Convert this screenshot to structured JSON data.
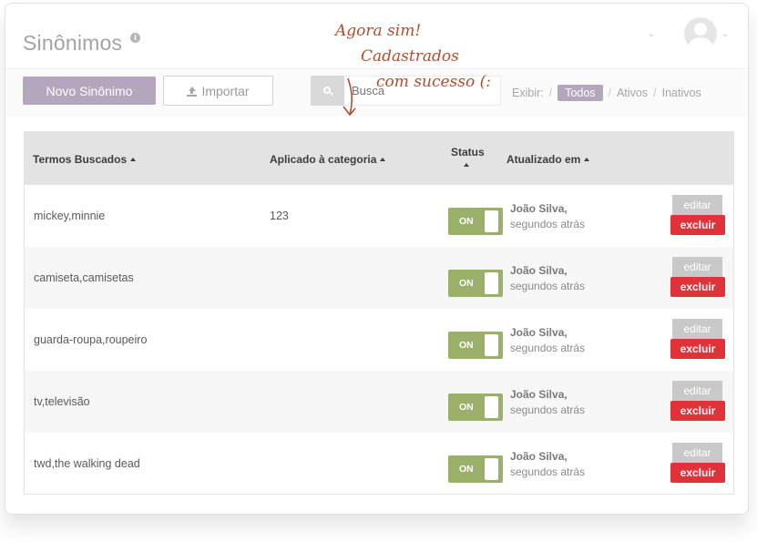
{
  "header": {
    "title": "Sinônimos",
    "info_glyph": "i"
  },
  "toolbar": {
    "new_label": "Novo Sinônimo",
    "import_label": "Importar",
    "search_placeholder": "Busca",
    "filter_label": "Exibir:",
    "filters": [
      "Todos",
      "Ativos",
      "Inativos"
    ],
    "active_filter": "Todos"
  },
  "table": {
    "columns": {
      "terms": "Termos Buscados",
      "category": "Aplicado à categoria",
      "status": "Status",
      "updated": "Atualizado em"
    },
    "rows": [
      {
        "terms": "mickey,minnie",
        "category": "123",
        "status": "ON",
        "user": "João Silva,",
        "time": "segundos atrás",
        "edit": "editar",
        "delete": "excluir"
      },
      {
        "terms": "camiseta,camisetas",
        "category": "",
        "status": "ON",
        "user": "João Silva,",
        "time": "segundos atrás",
        "edit": "editar",
        "delete": "excluir"
      },
      {
        "terms": "guarda-roupa,roupeiro",
        "category": "",
        "status": "ON",
        "user": "João Silva,",
        "time": "segundos atrás",
        "edit": "editar",
        "delete": "excluir"
      },
      {
        "terms": "tv,televisão",
        "category": "",
        "status": "ON",
        "user": "João Silva,",
        "time": "segundos atrás",
        "edit": "editar",
        "delete": "excluir"
      },
      {
        "terms": "twd,the walking dead",
        "category": "",
        "status": "ON",
        "user": "João Silva,",
        "time": "segundos atrás",
        "edit": "editar",
        "delete": "excluir"
      }
    ]
  },
  "annotation": {
    "line1": "Agora sim!",
    "line2": "Cadastrados",
    "line3": "com sucesso (:"
  },
  "colors": {
    "accent": "#b4a6bd",
    "toggle_on": "#9bb06a",
    "danger": "#e1323a",
    "annotation": "#b04e30"
  }
}
